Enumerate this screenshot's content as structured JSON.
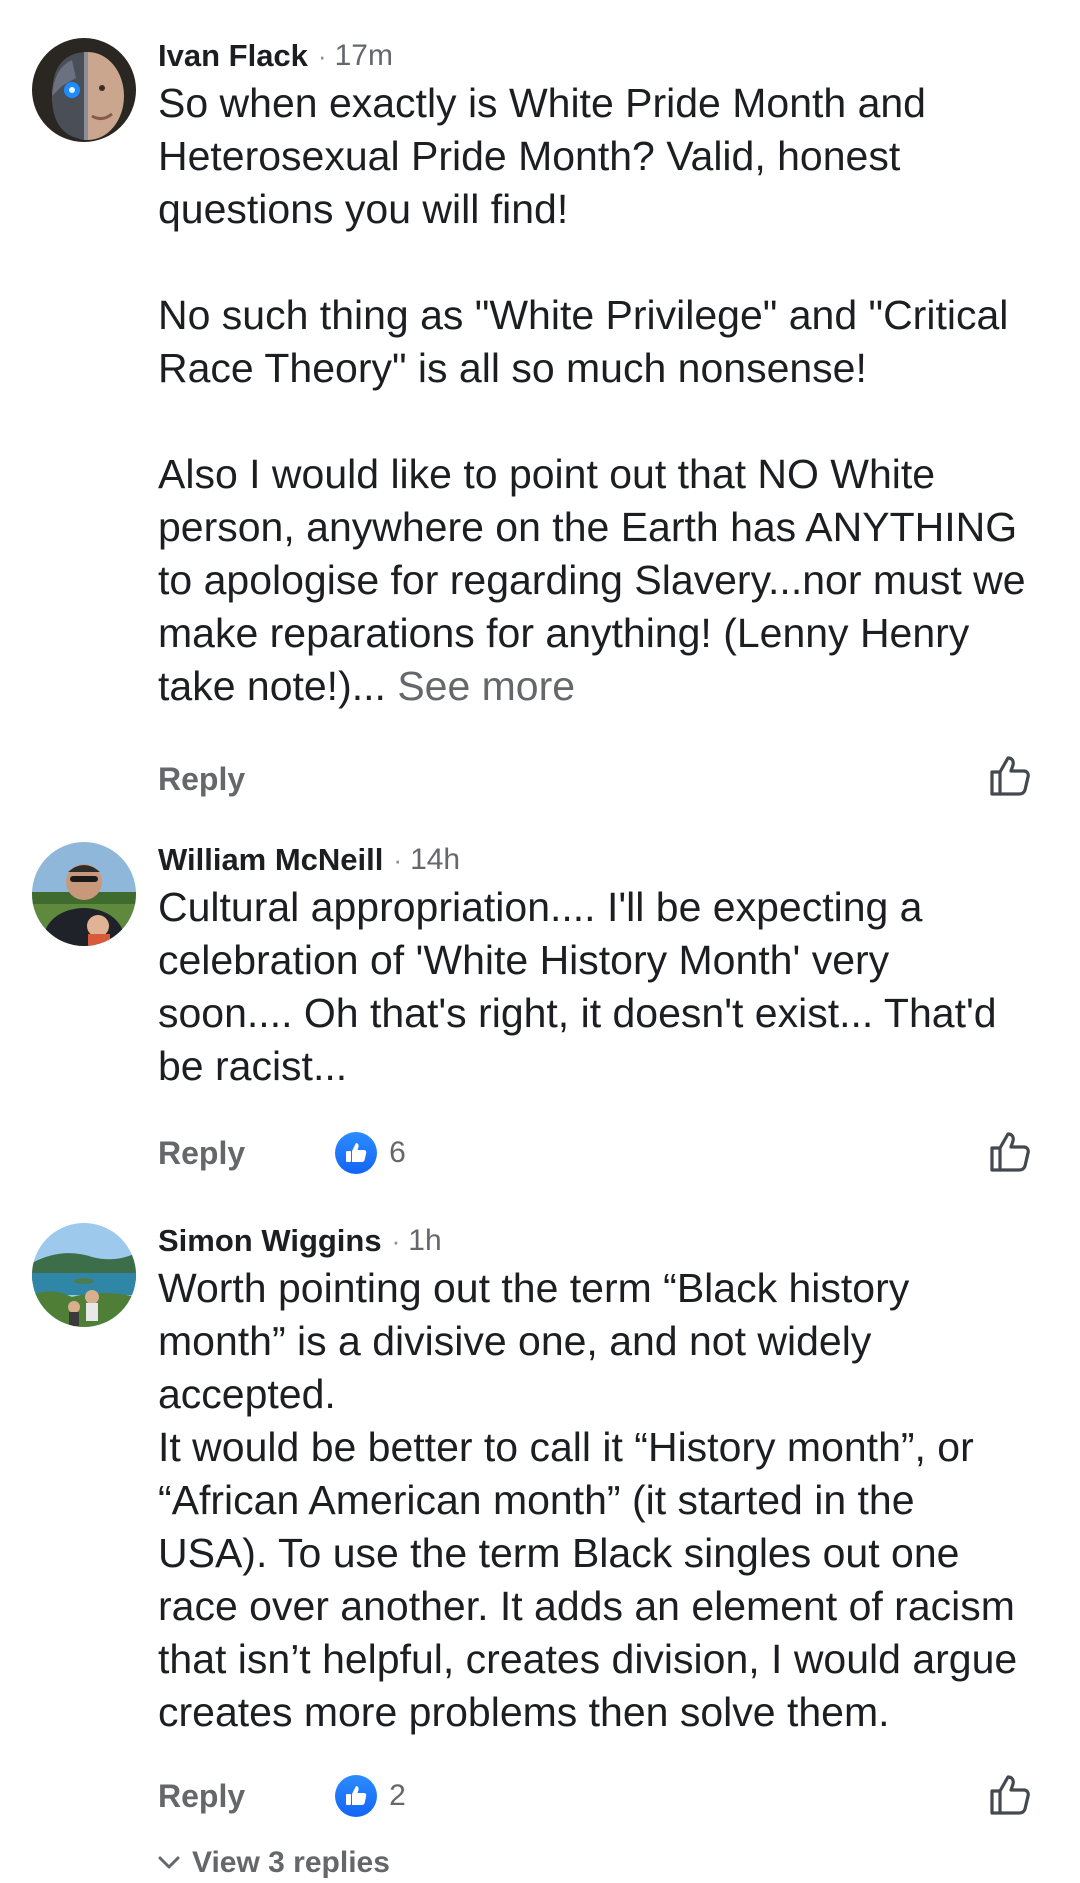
{
  "reply_label": "Reply",
  "comments": [
    {
      "author": "Ivan Flack",
      "time": "17m",
      "avatar_icon": "avatar-cyborg-face",
      "lines": [
        "So when exactly is White Pride Month and",
        "Heterosexual Pride Month? Valid, honest",
        "questions you will find!",
        "",
        "No such thing as \"White Privilege\" and \"Critical",
        "Race Theory\" is all so much nonsense!",
        "",
        "Also I would like to point out that NO White",
        "person, anywhere on the Earth has ANYTHING",
        "to apologise for regarding Slavery...nor must we",
        "make reparations for anything! (Lenny Henry"
      ],
      "last_line": "take note!)...",
      "see_more": "See more"
    },
    {
      "author": "William McNeill",
      "time": "14h",
      "avatar_icon": "avatar-man-outdoors",
      "lines": [
        "Cultural appropriation.... I'll be expecting a",
        "celebration of 'White History Month' very",
        "soon.... Oh that's right, it doesn't exist... That'd",
        "be racist..."
      ],
      "reaction_count": "6"
    },
    {
      "author": "Simon Wiggins",
      "time": "1h",
      "avatar_icon": "avatar-lake-landscape",
      "lines": [
        "Worth pointing out the term “Black history",
        "month” is a divisive one, and not widely",
        "accepted.",
        "It would be better to call it “History month”, or",
        "“African American month” (it started in the",
        "USA). To use the term Black singles out one",
        "race over another. It adds an element of racism",
        "that isn’t helpful, creates division, I would argue",
        "creates more problems then solve them."
      ],
      "reaction_count": "2",
      "view_replies": "View 3 replies"
    }
  ],
  "colors": {
    "text": "#1c1e21",
    "secondary": "#65676b",
    "like_blue": "#1877f2"
  }
}
